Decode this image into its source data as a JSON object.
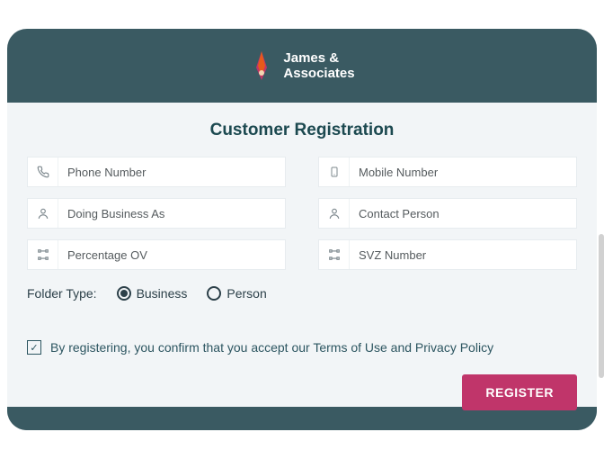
{
  "brand": {
    "line1": "James &",
    "line2": "Associates"
  },
  "title": "Customer Registration",
  "fields": {
    "phone": {
      "placeholder": "Phone Number"
    },
    "mobile": {
      "placeholder": "Mobile Number"
    },
    "dba": {
      "placeholder": "Doing Business As"
    },
    "contact": {
      "placeholder": "Contact Person"
    },
    "percentage": {
      "placeholder": "Percentage OV"
    },
    "svz": {
      "placeholder": "SVZ Number"
    }
  },
  "folderType": {
    "label": "Folder Type:",
    "option1": "Business",
    "option2": "Person",
    "selected": "Business"
  },
  "consent": {
    "checked": true,
    "text": "By registering, you confirm that you accept our Terms of Use and Privacy Policy"
  },
  "buttons": {
    "register": "REGISTER"
  }
}
